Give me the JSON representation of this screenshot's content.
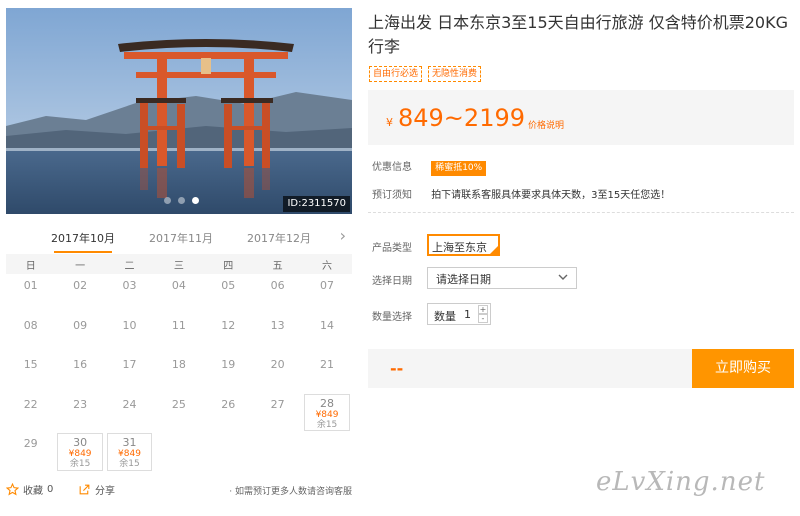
{
  "product": {
    "title": "上海出发 日本东京3至15天自由行旅游 仅含特价机票20KG行李",
    "tags": [
      "自由行必选",
      "无隐性消费"
    ],
    "price_currency": "¥",
    "price_range": "849~2199",
    "price_note": "价格说明",
    "promo_label": "优惠信息",
    "promo_badge": "稀蜜抵10%",
    "notice_label": "预订须知",
    "notice_text": "拍下请联系客服具体要求具体天数，3至15天任您选！"
  },
  "options": {
    "type_label": "产品类型",
    "type_value": "上海至东京",
    "date_label": "选择日期",
    "date_placeholder": "请选择日期",
    "qty_label": "数量选择",
    "qty_text": "数量",
    "qty_value": "1",
    "qty_plus": "+",
    "qty_minus": "-"
  },
  "buy": {
    "total": "--",
    "button_label": "立即购买"
  },
  "gallery": {
    "image_id": "ID:2311570",
    "dot_count": 3,
    "active_dot": 2
  },
  "calendar": {
    "months": [
      "2017年10月",
      "2017年11月",
      "2017年12月"
    ],
    "active_month": 0,
    "next_arrow": "›",
    "weekdays": [
      "日",
      "一",
      "二",
      "三",
      "四",
      "五",
      "六"
    ],
    "leading_blanks": 0,
    "days": [
      {
        "num": "01"
      },
      {
        "num": "02"
      },
      {
        "num": "03"
      },
      {
        "num": "04"
      },
      {
        "num": "05"
      },
      {
        "num": "06"
      },
      {
        "num": "07"
      },
      {
        "num": "08"
      },
      {
        "num": "09"
      },
      {
        "num": "10"
      },
      {
        "num": "11"
      },
      {
        "num": "12"
      },
      {
        "num": "13"
      },
      {
        "num": "14"
      },
      {
        "num": "15"
      },
      {
        "num": "16"
      },
      {
        "num": "17"
      },
      {
        "num": "18"
      },
      {
        "num": "19"
      },
      {
        "num": "20"
      },
      {
        "num": "21"
      },
      {
        "num": "22"
      },
      {
        "num": "23"
      },
      {
        "num": "24"
      },
      {
        "num": "25"
      },
      {
        "num": "26"
      },
      {
        "num": "27"
      },
      {
        "num": "28",
        "price": "¥849",
        "left": "余15"
      },
      {
        "num": "29"
      },
      {
        "num": "30",
        "price": "¥849",
        "left": "余15"
      },
      {
        "num": "31",
        "price": "¥849",
        "left": "余15"
      }
    ]
  },
  "footer": {
    "favorite_label": "收藏",
    "favorite_count": "0",
    "share_label": "分享",
    "consult_text": "· 如需预订更多人数请咨询客服"
  },
  "watermark": "eLvXing.net",
  "colors": {
    "accent": "#ff8a00",
    "price": "#ff6a00",
    "buy_button": "#ff9500"
  }
}
